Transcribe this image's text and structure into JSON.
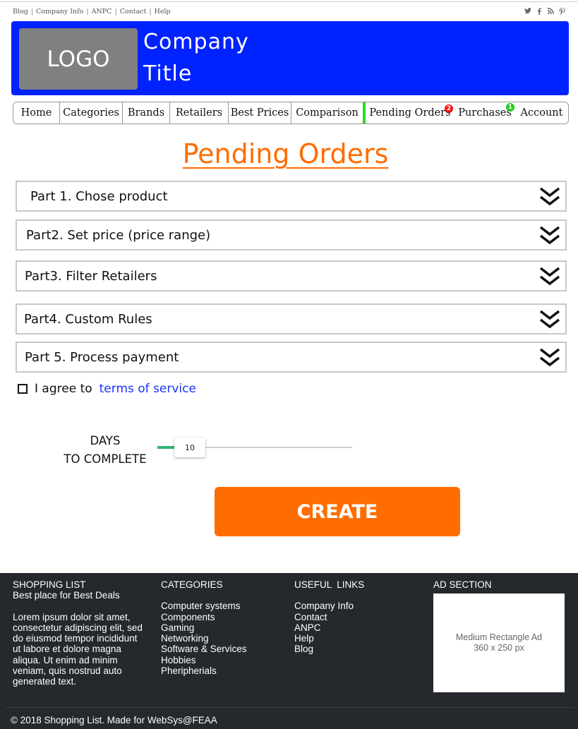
{
  "topbar": {
    "links": [
      "Blog",
      "Company Info",
      "ANPC",
      "Contact",
      "Help"
    ],
    "separator": "|",
    "social_icons": [
      "twitter-icon",
      "facebook-icon",
      "rss-icon",
      "pinterest-icon"
    ]
  },
  "header": {
    "logo_text": "LOGO",
    "title_line1": "Company",
    "title_line2": "Title",
    "bg_color": "#0022ff"
  },
  "nav": {
    "items": [
      {
        "label": "Home"
      },
      {
        "label": "Categories"
      },
      {
        "label": "Brands"
      },
      {
        "label": "Retailers"
      },
      {
        "label": "Best Prices"
      },
      {
        "label": "Comparison"
      },
      {
        "label": "Pending Orders",
        "badge": "2",
        "badge_color": "#ee1111"
      },
      {
        "label": "Purchases",
        "badge": "1",
        "badge_color": "#22cc22"
      },
      {
        "label": "Account"
      }
    ]
  },
  "page": {
    "title": "Pending Orders",
    "title_color": "#ff6d00"
  },
  "sections": [
    {
      "label": "Part 1. Chose product"
    },
    {
      "label": "Part2. Set price (price range)"
    },
    {
      "label": "Part3. Filter Retailers"
    },
    {
      "label": "Part4. Custom Rules"
    },
    {
      "label": "Part 5. Process payment"
    }
  ],
  "agree": {
    "prefix": "I agree to",
    "link": "terms of service",
    "checked": false
  },
  "days": {
    "label_line1": "DAYS",
    "label_line2": "TO COMPLETE",
    "value": "10",
    "fill_color": "#2bb673"
  },
  "create_button": {
    "label": "CREATE",
    "color": "#ff6d00"
  },
  "footer": {
    "col1": {
      "heading": "SHOPPING LIST",
      "subheading": "Best place for Best Deals",
      "text": "Lorem ipsum dolor sit amet, consectetur adipiscing elit, sed do eiusmod tempor incididunt ut labore et dolore magna aliqua. Ut enim ad minim veniam, quis nostrud auto generated text."
    },
    "col2": {
      "heading": "CATEGORIES",
      "links": [
        "Computer systems",
        "Components",
        "Gaming",
        "Networking",
        "Software & Services",
        "Hobbies",
        "Pheripherials"
      ]
    },
    "col3": {
      "heading": "USEFUL  LINKS",
      "links": [
        "Company Info",
        "Contact",
        "ANPC",
        "Help",
        "Blog"
      ]
    },
    "ad": {
      "heading": "AD SECTION",
      "line1": "Medium Rectangle Ad",
      "line2": "360 x 250 px"
    },
    "copyright": "© 2018 Shopping List. Made for WebSys@FEAA",
    "bg_color": "#25282d"
  }
}
